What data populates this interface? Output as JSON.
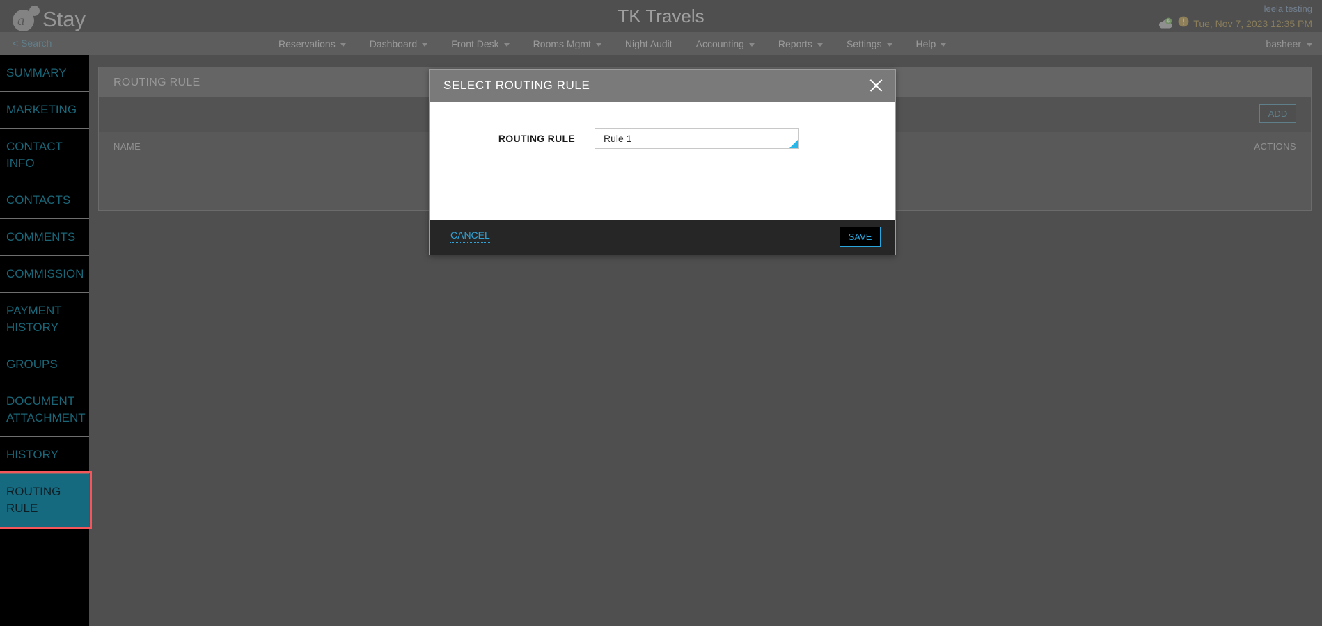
{
  "topbar": {
    "logo_text": "Stay",
    "logo_icon": "astay-logo-icon",
    "app_title": "TK Travels",
    "user_name": "leela testing",
    "sync_date": "Tue, Nov 7, 2023 12:35 PM",
    "cloud_icon": "cloud-sync-icon",
    "warning_icon": "warning-icon"
  },
  "nav": {
    "search_label": "< Search",
    "items": [
      {
        "label": "Reservations",
        "has_caret": true
      },
      {
        "label": "Dashboard",
        "has_caret": true
      },
      {
        "label": "Front Desk",
        "has_caret": true
      },
      {
        "label": "Rooms Mgmt",
        "has_caret": true
      },
      {
        "label": "Night Audit",
        "has_caret": false
      },
      {
        "label": "Accounting",
        "has_caret": true
      },
      {
        "label": "Reports",
        "has_caret": true
      },
      {
        "label": "Settings",
        "has_caret": true
      },
      {
        "label": "Help",
        "has_caret": true
      }
    ],
    "user_label": "basheer"
  },
  "sidebar": {
    "items": [
      {
        "label": "SUMMARY",
        "active": false
      },
      {
        "label": "MARKETING",
        "active": false
      },
      {
        "label": "CONTACT INFO",
        "active": false
      },
      {
        "label": "CONTACTS",
        "active": false
      },
      {
        "label": "COMMENTS",
        "active": false
      },
      {
        "label": "COMMISSION",
        "active": false
      },
      {
        "label": "PAYMENT HISTORY",
        "active": false
      },
      {
        "label": "GROUPS",
        "active": false
      },
      {
        "label": "DOCUMENT ATTACHMENT",
        "active": false
      },
      {
        "label": "HISTORY",
        "active": false
      },
      {
        "label": "ROUTING RULE",
        "active": true
      }
    ]
  },
  "panel": {
    "title": "ROUTING RULE",
    "add_label": "ADD",
    "columns": [
      "NAME",
      "ACTIONS"
    ],
    "rows": []
  },
  "modal": {
    "title": "SELECT ROUTING RULE",
    "close_icon": "close-icon",
    "field_label": "ROUTING RULE",
    "field_value": "Rule 1",
    "field_placeholder": "Rule 1",
    "cancel_label": "CANCEL",
    "save_label": "SAVE"
  },
  "colors": {
    "accent_cyan": "#29a6dd",
    "sidebar_teal": "#166a80",
    "highlight_red": "#f4565c",
    "date_gold": "#9a7a22"
  }
}
